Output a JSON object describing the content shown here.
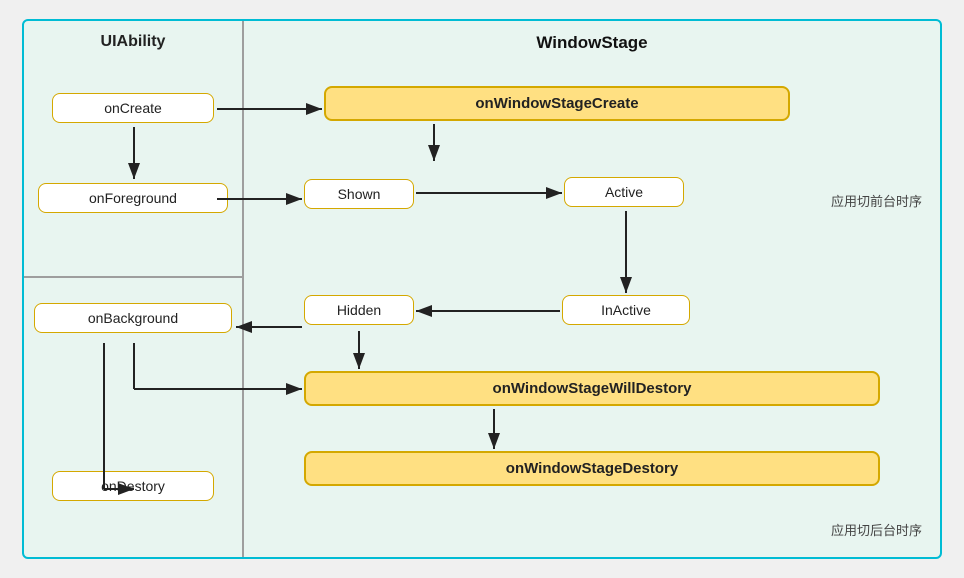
{
  "diagram": {
    "title_left": "UIAbility",
    "title_right": "WindowStage",
    "label_foreground": "应用切前台时序",
    "label_background": "应用切后台时序",
    "nodes": {
      "onCreate": "onCreate",
      "onForeground": "onForeground",
      "onBackground": "onBackground",
      "onDestory": "onDestory",
      "onWindowStageCreate": "onWindowStageCreate",
      "shown": "Shown",
      "active": "Active",
      "inactive": "InActive",
      "hidden": "Hidden",
      "onWindowStageWillDestory": "onWindowStageWillDestory",
      "onWindowStageDestory": "onWindowStageDestory"
    }
  }
}
